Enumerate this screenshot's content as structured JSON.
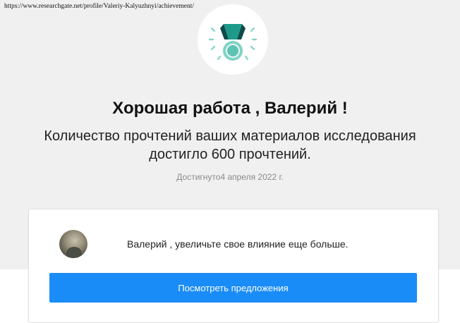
{
  "browser": {
    "url": "https://www.researchgate.net/profile/Valeriy-Kalyuzhnyi/achievement/"
  },
  "achievement": {
    "icon": "medal-icon",
    "title": "Хорошая работа , Валерий !",
    "message": "Количество прочтений ваших материалов исследования достигло 600 прочтений.",
    "achieved_date": "Достигнуто4 апреля 2022 г."
  },
  "promo_card": {
    "avatar": "user-avatar",
    "text": "Валерий , увеличьте свое влияние еще больше.",
    "button_label": "Посмотреть предложения"
  },
  "colors": {
    "accent": "#1a8cf7",
    "medal_teal": "#1d9a8a",
    "medal_dark": "#0e4a4b",
    "medal_light": "#7fd3c6"
  }
}
